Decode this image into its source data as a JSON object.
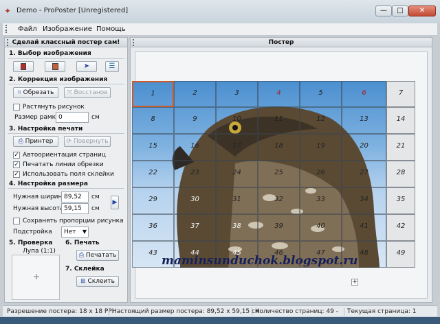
{
  "window": {
    "title": "Demo - ProPoster [Unregistered]",
    "minimize": "—",
    "maximize": "□",
    "close": "✕"
  },
  "menu": {
    "items": [
      "Файл",
      "Изображение",
      "Помощь"
    ]
  },
  "left_panel": {
    "header": "Сделай классный постер сам!",
    "sections": {
      "select": "1. Выбор изображения",
      "correct": "2. Коррекция изображения",
      "print_setup": "3. Настройка печати",
      "size_setup": "4. Настройка размера",
      "preview": "5. Проверка",
      "print": "6. Печать",
      "glue": "7. Склейка"
    },
    "crop_button": "Обрезать",
    "restore_button": "Восстанов",
    "stretch_label": "Растянуть рисунок",
    "frame_size_label": "Размер рамки",
    "frame_size_value": "0",
    "frame_size_unit": "см",
    "printer_button": "Принтер",
    "rotate_button": "Повернуть",
    "auto_orient_label": "Автоориентация страниц",
    "print_cut_lines_label": "Печатать линии обрезки",
    "use_glue_margins_label": "Использовать поля склейки",
    "width_label": "Нужная ширина",
    "width_value": "89,52",
    "width_unit": "см",
    "height_label": "Нужная высота",
    "height_value": "59,15",
    "height_unit": "см",
    "keep_ratio_label": "Сохранять пропорции рисунка",
    "adjust_label": "Подстройка",
    "adjust_value": "Нет",
    "magnifier_label": "Лупа (1:1)",
    "print_button": "Печатать",
    "glue_button": "Склеить"
  },
  "right_panel": {
    "header": "Постер"
  },
  "poster": {
    "tiles": [
      "1",
      "2",
      "3",
      "4",
      "5",
      "6",
      "7",
      "8",
      "9",
      "10",
      "11",
      "12",
      "13",
      "14",
      "15",
      "16",
      "17",
      "18",
      "19",
      "20",
      "21",
      "22",
      "23",
      "24",
      "25",
      "26",
      "27",
      "28",
      "29",
      "30",
      "31",
      "32",
      "33",
      "34",
      "35",
      "36",
      "37",
      "38",
      "39",
      "40",
      "41",
      "42",
      "43",
      "44",
      "45",
      "46",
      "47",
      "48",
      "49"
    ],
    "watermark": "maminsunduchok.blogspot.ru"
  },
  "status": {
    "resolution": "Разрешение постера: 18 x 18 PPI",
    "actual_size": "Настоящий размер постера: 89,52 x 59,15 см",
    "page_count": "Количество страниц: 49 -",
    "current_page": "Текущая страница: 1"
  },
  "colors": {
    "accent_selected_tile": "#c85a2b",
    "red_tile_numbers": "#a3221a"
  }
}
